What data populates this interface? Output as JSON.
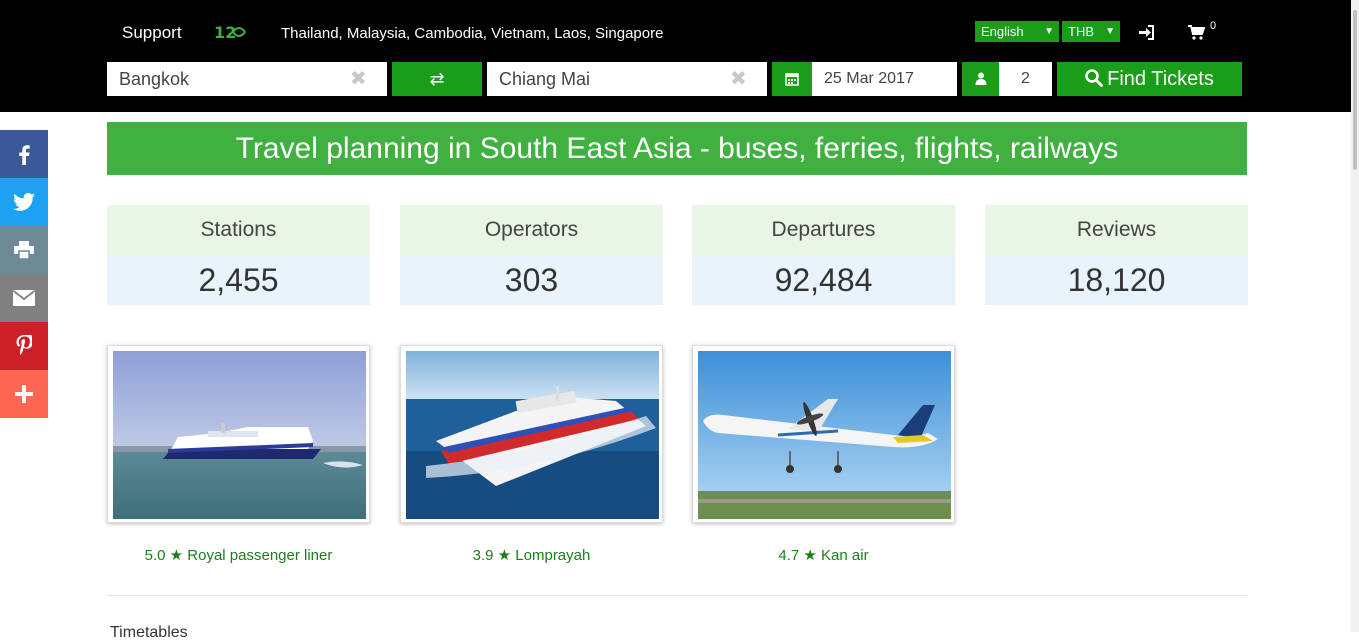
{
  "header": {
    "support_label": "Support",
    "countries": "Thailand, Malaysia, Cambodia, Vietnam, Laos, Singapore",
    "language": "English",
    "currency": "THB",
    "cart_count": "0"
  },
  "search": {
    "from": "Bangkok",
    "to": "Chiang Mai",
    "date": "25 Mar 2017",
    "passengers": "2",
    "find_label": "Find Tickets"
  },
  "banner": {
    "title": "Travel planning in South East Asia - buses, ferries, flights, railways"
  },
  "stats": [
    {
      "label": "Stations",
      "value": "2,455"
    },
    {
      "label": "Operators",
      "value": "303"
    },
    {
      "label": "Departures",
      "value": "92,484"
    },
    {
      "label": "Reviews",
      "value": "18,120"
    }
  ],
  "operators": [
    {
      "caption": "5.0 ★ Royal passenger liner"
    },
    {
      "caption": "3.9 ★ Lomprayah"
    },
    {
      "caption": "4.7 ★ Kan air"
    }
  ],
  "below_text": "Timetables",
  "colors": {
    "brand_green": "#1a9e1a",
    "banner_green": "#40b041",
    "facebook": "#3b5998",
    "twitter": "#1da1f2",
    "print": "#6d8a94",
    "email": "#808080",
    "pinterest": "#cb2027",
    "more": "#ff6550"
  }
}
